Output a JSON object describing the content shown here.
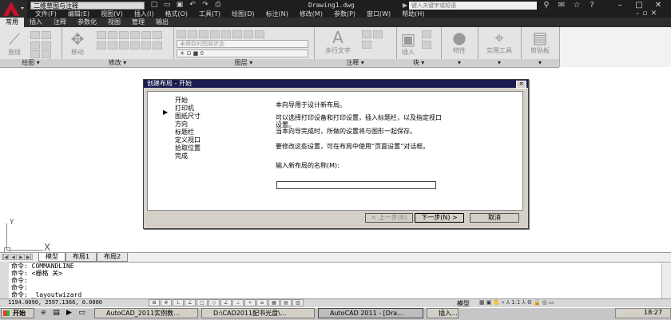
{
  "app": {
    "workspace": "二维草图与注释",
    "document_title": "Drawing1.dwg",
    "search_placeholder": "键入关键字或短语",
    "menu": [
      "文件(F)",
      "编辑(E)",
      "视图(V)",
      "插入(I)",
      "格式(O)",
      "工具(T)",
      "绘图(D)",
      "标注(N)",
      "修改(M)",
      "参数(P)",
      "窗口(W)",
      "帮助(H)"
    ]
  },
  "ribbon": {
    "tabs": [
      "常用",
      "插入",
      "注释",
      "参数化",
      "视图",
      "管理",
      "输出"
    ],
    "active_tab": "常用",
    "panels": {
      "draw": {
        "label": "绘图",
        "big_button": "直线"
      },
      "modify": {
        "label": "修改",
        "big_button": "移动"
      },
      "layers": {
        "label": "图层",
        "layer_state": "未保存的图层状态",
        "layer_current": "0"
      },
      "annotation": {
        "label": "注释",
        "big_button": "多行文字"
      },
      "block": {
        "label": "块",
        "big_button": "插入"
      },
      "properties": {
        "big_button": "特性"
      },
      "utilities": {
        "big_button": "实用工具"
      },
      "clipboard": {
        "big_button": "剪贴板"
      }
    }
  },
  "ucs": {
    "y": "Y",
    "x": "X"
  },
  "layout_tabs": [
    "模型",
    "布局1",
    "布局2"
  ],
  "command": {
    "lines": [
      "命令: COMMANDLINE",
      "命令: <栅格 关>",
      "命令:",
      "命令:",
      "命令: _layoutwizard"
    ]
  },
  "status": {
    "coords": "1194.0090, 2597.1366, 0.0000",
    "model": "模型",
    "scale": "1:1"
  },
  "dialog": {
    "title": "创建布局 - 开始",
    "close": "✕",
    "steps": [
      "开始",
      "打印机",
      "图纸尺寸",
      "方向",
      "标题栏",
      "定义视口",
      "拾取位置",
      "完成"
    ],
    "current_step_marker": "▶",
    "desc1": "本向导用于设计新布局。",
    "desc2": "可以选择打印设备和打印设置，插入标题栏，以及指定视口设置。",
    "desc3": "当本向导完成时，所做的设置将与图形一起保存。",
    "desc4": "要修改这些设置，可在布局中使用“页面设置”对话框。",
    "input_label": "输入新布局的名称(M):",
    "input_value": "",
    "back": "< 上一步(B)",
    "next": "下一步(N) >",
    "cancel": "取消"
  },
  "taskbar": {
    "start": "开始",
    "tasks": [
      "AutoCAD_2011实例教...",
      "D:\\CAD2011配书光盘\\...",
      "AutoCAD 2011 - [Dra...",
      "插入..."
    ],
    "clock": "18:27"
  }
}
